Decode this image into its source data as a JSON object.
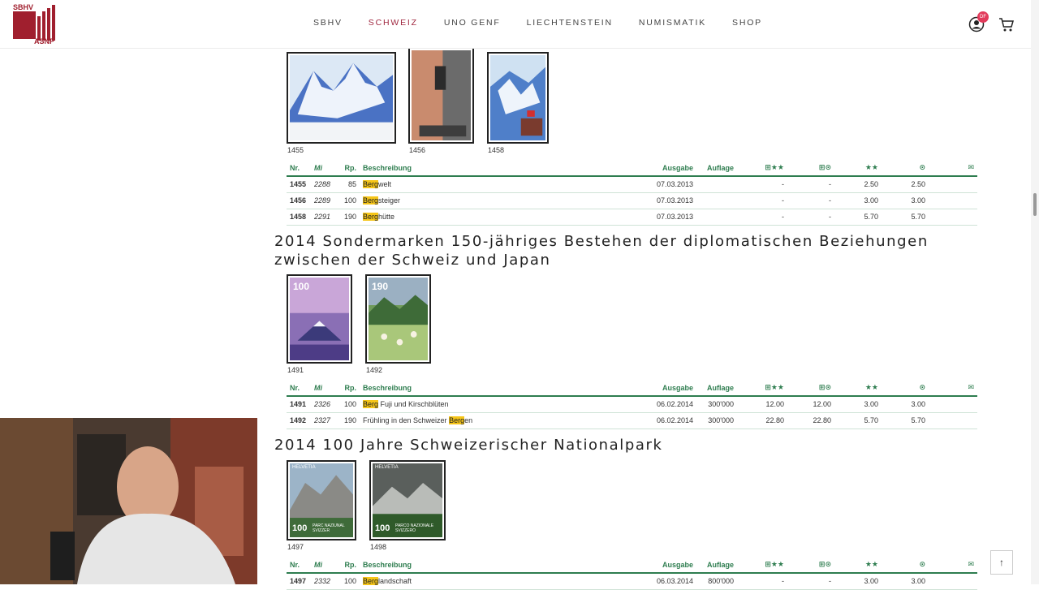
{
  "header": {
    "logo_top": "SBHV",
    "logo_bottom": "ASNP",
    "nav": [
      "SBHV",
      "SCHWEIZ",
      "UNO GENF",
      "LIECHTENSTEIN",
      "NUMISMATIK",
      "SHOP"
    ],
    "active_nav": "SCHWEIZ",
    "user_badge": "DF"
  },
  "columns": {
    "nr": "Nr.",
    "mi": "Mi",
    "rp": "Rp.",
    "desc": "Beschreibung",
    "ausgabe": "Ausgabe",
    "auflage": "Auflage"
  },
  "section1": {
    "stamps": [
      "1455",
      "1456",
      "1458"
    ],
    "rows": [
      {
        "nr": "1455",
        "mi": "2288",
        "rp": "85",
        "hl": "Berg",
        "rest": "welt",
        "ausgabe": "07.03.2013",
        "auflage": "",
        "a": "-",
        "b": "-",
        "c": "2.50",
        "d": "2.50"
      },
      {
        "nr": "1456",
        "mi": "2289",
        "rp": "100",
        "hl": "Berg",
        "rest": "steiger",
        "ausgabe": "07.03.2013",
        "auflage": "",
        "a": "-",
        "b": "-",
        "c": "3.00",
        "d": "3.00"
      },
      {
        "nr": "1458",
        "mi": "2291",
        "rp": "190",
        "hl": "Berg",
        "rest": "hütte",
        "ausgabe": "07.03.2013",
        "auflage": "",
        "a": "-",
        "b": "-",
        "c": "5.70",
        "d": "5.70"
      }
    ]
  },
  "section2": {
    "title_line1": "2014 Sondermarken 150-jähriges Bestehen der diplomatischen Beziehungen",
    "title_line2": "zwischen der Schweiz und Japan",
    "stamps": [
      "1491",
      "1492"
    ],
    "stamp_values": [
      "100",
      "190"
    ],
    "rows": [
      {
        "nr": "1491",
        "mi": "2326",
        "rp": "100",
        "pre": "",
        "hl": "Berg",
        "rest": " Fuji und Kirschblüten",
        "ausgabe": "06.02.2014",
        "auflage": "300'000",
        "a": "12.00",
        "b": "12.00",
        "c": "3.00",
        "d": "3.00"
      },
      {
        "nr": "1492",
        "mi": "2327",
        "rp": "190",
        "pre": "Frühling in den Schweizer ",
        "hl": "Berg",
        "rest": "en",
        "ausgabe": "06.02.2014",
        "auflage": "300'000",
        "a": "22.80",
        "b": "22.80",
        "c": "5.70",
        "d": "5.70"
      }
    ]
  },
  "section3": {
    "title": "2014 100 Jahre Schweizerischer Nationalpark",
    "stamps": [
      "1497",
      "1498"
    ],
    "stamp_labels": [
      "HELVETIA",
      "HELVETIA"
    ],
    "stamp_values": [
      "100",
      "100"
    ],
    "stamp_caption": [
      "PARC NAZIUNAL SVIZZER",
      "PARCO NAZIONALE SVIZZERO"
    ],
    "rows": [
      {
        "nr": "1497",
        "mi": "2332",
        "rp": "100",
        "hl": "Berg",
        "rest": "landschaft",
        "ausgabe": "06.03.2014",
        "auflage": "800'000",
        "a": "-",
        "b": "-",
        "c": "3.00",
        "d": "3.00"
      }
    ]
  },
  "colors": {
    "accent": "#2e7d4f",
    "active_nav": "#a02840",
    "highlight": "#f5c518"
  }
}
